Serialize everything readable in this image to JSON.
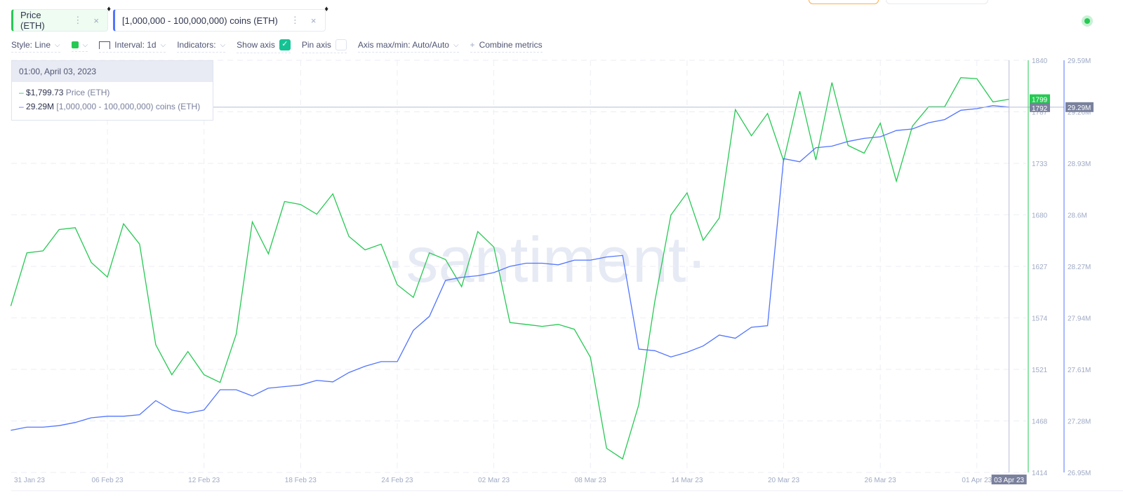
{
  "metrics": [
    {
      "label": "Price (ETH)",
      "color": "#26c953"
    },
    {
      "label": "[1,000,000 - 100,000,000) coins (ETH)",
      "color": "#5275ff"
    }
  ],
  "toolbar": {
    "style": "Style: Line",
    "interval": "Interval: 1d",
    "indicators": "Indicators:",
    "show_axis": "Show axis",
    "show_axis_checked": true,
    "pin_axis": "Pin axis",
    "pin_axis_checked": false,
    "axis_maxmin": "Axis max/min: Auto/Auto",
    "combine": "Combine metrics"
  },
  "tooltip": {
    "date": "01:00, April 03, 2023",
    "price_value": "$1,799.73",
    "price_label": "Price (ETH)",
    "coins_value": "29.29M",
    "coins_label": "[1,000,000 - 100,000,000) coins (ETH)"
  },
  "watermark": "·santiment·",
  "chart_data": {
    "type": "line",
    "x_start": "2023-01-31",
    "interval": "1d",
    "x_ticks": [
      "31 Jan 23",
      "06 Feb 23",
      "12 Feb 23",
      "18 Feb 23",
      "24 Feb 23",
      "02 Mar 23",
      "08 Mar 23",
      "14 Mar 23",
      "20 Mar 23",
      "26 Mar 23",
      "01 Apr 23"
    ],
    "x_tick_days": [
      0,
      6,
      12,
      18,
      24,
      30,
      36,
      42,
      48,
      54,
      60
    ],
    "crosshair": {
      "x_label": "03 Apr 23",
      "price_label": "1799",
      "price_cursor": "1792",
      "coins_label": "29.29M",
      "coins_value": 29.29
    },
    "left_axis": {
      "ylim": [
        1414,
        1840
      ],
      "ticks": [
        "1840",
        "1787",
        "1733",
        "1680",
        "1627",
        "1574",
        "1521",
        "1468",
        "1414"
      ]
    },
    "right_axis": {
      "ylim": [
        26.95,
        29.59
      ],
      "ticks": [
        "29.59M",
        "29.26M",
        "28.93M",
        "28.6M",
        "28.27M",
        "27.94M",
        "27.61M",
        "27.28M",
        "26.95M"
      ]
    },
    "series": [
      {
        "name": "Price (ETH)",
        "axis": "left",
        "color": "#26c953",
        "values": [
          1586,
          1641,
          1643,
          1665,
          1667,
          1631,
          1616,
          1671,
          1650,
          1546,
          1515,
          1539,
          1515,
          1507,
          1557,
          1673,
          1640,
          1694,
          1691,
          1681,
          1702,
          1658,
          1644,
          1650,
          1608,
          1595,
          1641,
          1634,
          1606,
          1663,
          1647,
          1569,
          1567,
          1565,
          1567,
          1562,
          1533,
          1439,
          1428,
          1484,
          1591,
          1680,
          1703,
          1654,
          1677,
          1789,
          1762,
          1785,
          1736,
          1808,
          1737,
          1817,
          1752,
          1744,
          1775,
          1715,
          1772,
          1792,
          1792,
          1822,
          1821,
          1797,
          1799.73
        ]
      },
      {
        "name": "[1,000,000 - 100,000,000) coins (ETH)",
        "axis": "right",
        "color": "#5275ff",
        "values": [
          27.22,
          27.24,
          27.24,
          27.25,
          27.27,
          27.3,
          27.31,
          27.31,
          27.32,
          27.41,
          27.35,
          27.33,
          27.35,
          27.48,
          27.48,
          27.44,
          27.49,
          27.5,
          27.51,
          27.54,
          27.53,
          27.59,
          27.63,
          27.66,
          27.66,
          27.86,
          27.95,
          28.18,
          28.2,
          28.21,
          28.23,
          28.27,
          28.29,
          28.29,
          28.28,
          28.31,
          28.31,
          28.33,
          28.34,
          27.74,
          27.73,
          27.69,
          27.72,
          27.76,
          27.83,
          27.81,
          27.88,
          27.89,
          28.96,
          28.94,
          29.03,
          29.04,
          29.07,
          29.09,
          29.1,
          29.14,
          29.15,
          29.19,
          29.21,
          29.27,
          29.28,
          29.3,
          29.29
        ]
      }
    ]
  }
}
